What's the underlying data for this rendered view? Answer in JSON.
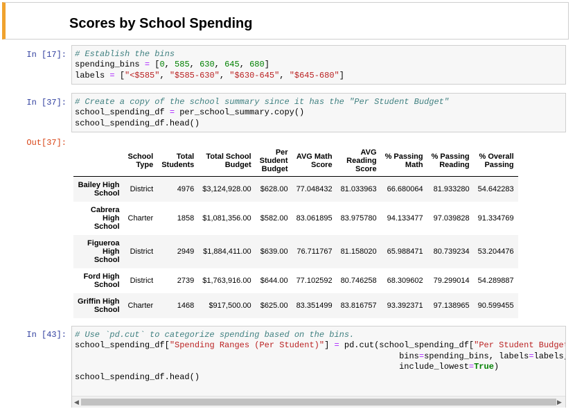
{
  "heading": "Scores by School Spending",
  "cells": [
    {
      "prompt": "In [17]:",
      "lines": [
        [
          [
            "cm",
            "# Establish the bins"
          ]
        ],
        [
          [
            "",
            "spending_bins "
          ],
          [
            "op",
            "="
          ],
          [
            "",
            " ["
          ],
          [
            "nu",
            "0"
          ],
          [
            "",
            ", "
          ],
          [
            "nu",
            "585"
          ],
          [
            "",
            ", "
          ],
          [
            "nu",
            "630"
          ],
          [
            "",
            ", "
          ],
          [
            "nu",
            "645"
          ],
          [
            "",
            ", "
          ],
          [
            "nu",
            "680"
          ],
          [
            "",
            "]"
          ]
        ],
        [
          [
            "",
            "labels "
          ],
          [
            "op",
            "="
          ],
          [
            "",
            " ["
          ],
          [
            "st",
            "\"<$585\""
          ],
          [
            "",
            ", "
          ],
          [
            "st",
            "\"$585-630\""
          ],
          [
            "",
            ", "
          ],
          [
            "st",
            "\"$630-645\""
          ],
          [
            "",
            ", "
          ],
          [
            "st",
            "\"$645-680\""
          ],
          [
            "",
            "]"
          ]
        ]
      ]
    },
    {
      "prompt": "In [37]:",
      "lines": [
        [
          [
            "cm",
            "# Create a copy of the school summary since it has the \"Per Student Budget\""
          ]
        ],
        [
          [
            "",
            "school_spending_df "
          ],
          [
            "op",
            "="
          ],
          [
            "",
            " per_school_summary.copy()"
          ]
        ],
        [
          [
            "",
            "school_spending_df.head()"
          ]
        ]
      ]
    },
    {
      "prompt": "In [43]:",
      "lines": [
        [
          [
            "cm",
            "# Use `pd.cut` to categorize spending based on the bins."
          ]
        ],
        [
          [
            "",
            "school_spending_df["
          ],
          [
            "st",
            "\"Spending Ranges (Per Student)\""
          ],
          [
            "",
            "] "
          ],
          [
            "op",
            "="
          ],
          [
            "",
            " pd.cut(school_spending_df["
          ],
          [
            "st",
            "\"Per Student Budget\""
          ],
          [
            "",
            "],"
          ]
        ],
        [
          [
            "",
            "                                                                 bins"
          ],
          [
            "op",
            "="
          ],
          [
            "",
            "spending_bins, labels"
          ],
          [
            "op",
            "="
          ],
          [
            "",
            "labels,"
          ]
        ],
        [
          [
            "",
            "                                                                 include_lowest"
          ],
          [
            "op",
            "="
          ],
          [
            "kw",
            "True"
          ],
          [
            "",
            ")"
          ]
        ],
        [
          [
            "",
            "school_spending_df.head()"
          ]
        ]
      ]
    }
  ],
  "output_prompt": "Out[37]:",
  "table": {
    "columns": [
      [
        "School",
        "Type"
      ],
      [
        "Total",
        "Students"
      ],
      [
        "Total School",
        "Budget"
      ],
      [
        "Per",
        "Student",
        "Budget"
      ],
      [
        "AVG Math",
        "Score"
      ],
      [
        "AVG",
        "Reading",
        "Score"
      ],
      [
        "% Passing",
        "Math"
      ],
      [
        "% Passing",
        "Reading"
      ],
      [
        "% Overall",
        "Passing"
      ]
    ],
    "rows": [
      {
        "index": [
          "Bailey High",
          "School"
        ],
        "values": [
          "District",
          "4976",
          "$3,124,928.00",
          "$628.00",
          "77.048432",
          "81.033963",
          "66.680064",
          "81.933280",
          "54.642283"
        ]
      },
      {
        "index": [
          "Cabrera",
          "High",
          "School"
        ],
        "values": [
          "Charter",
          "1858",
          "$1,081,356.00",
          "$582.00",
          "83.061895",
          "83.975780",
          "94.133477",
          "97.039828",
          "91.334769"
        ]
      },
      {
        "index": [
          "Figueroa",
          "High",
          "School"
        ],
        "values": [
          "District",
          "2949",
          "$1,884,411.00",
          "$639.00",
          "76.711767",
          "81.158020",
          "65.988471",
          "80.739234",
          "53.204476"
        ]
      },
      {
        "index": [
          "Ford High",
          "School"
        ],
        "values": [
          "District",
          "2739",
          "$1,763,916.00",
          "$644.00",
          "77.102592",
          "80.746258",
          "68.309602",
          "79.299014",
          "54.289887"
        ]
      },
      {
        "index": [
          "Griffin High",
          "School"
        ],
        "values": [
          "Charter",
          "1468",
          "$917,500.00",
          "$625.00",
          "83.351499",
          "83.816757",
          "93.392371",
          "97.138965",
          "90.599455"
        ]
      }
    ]
  }
}
